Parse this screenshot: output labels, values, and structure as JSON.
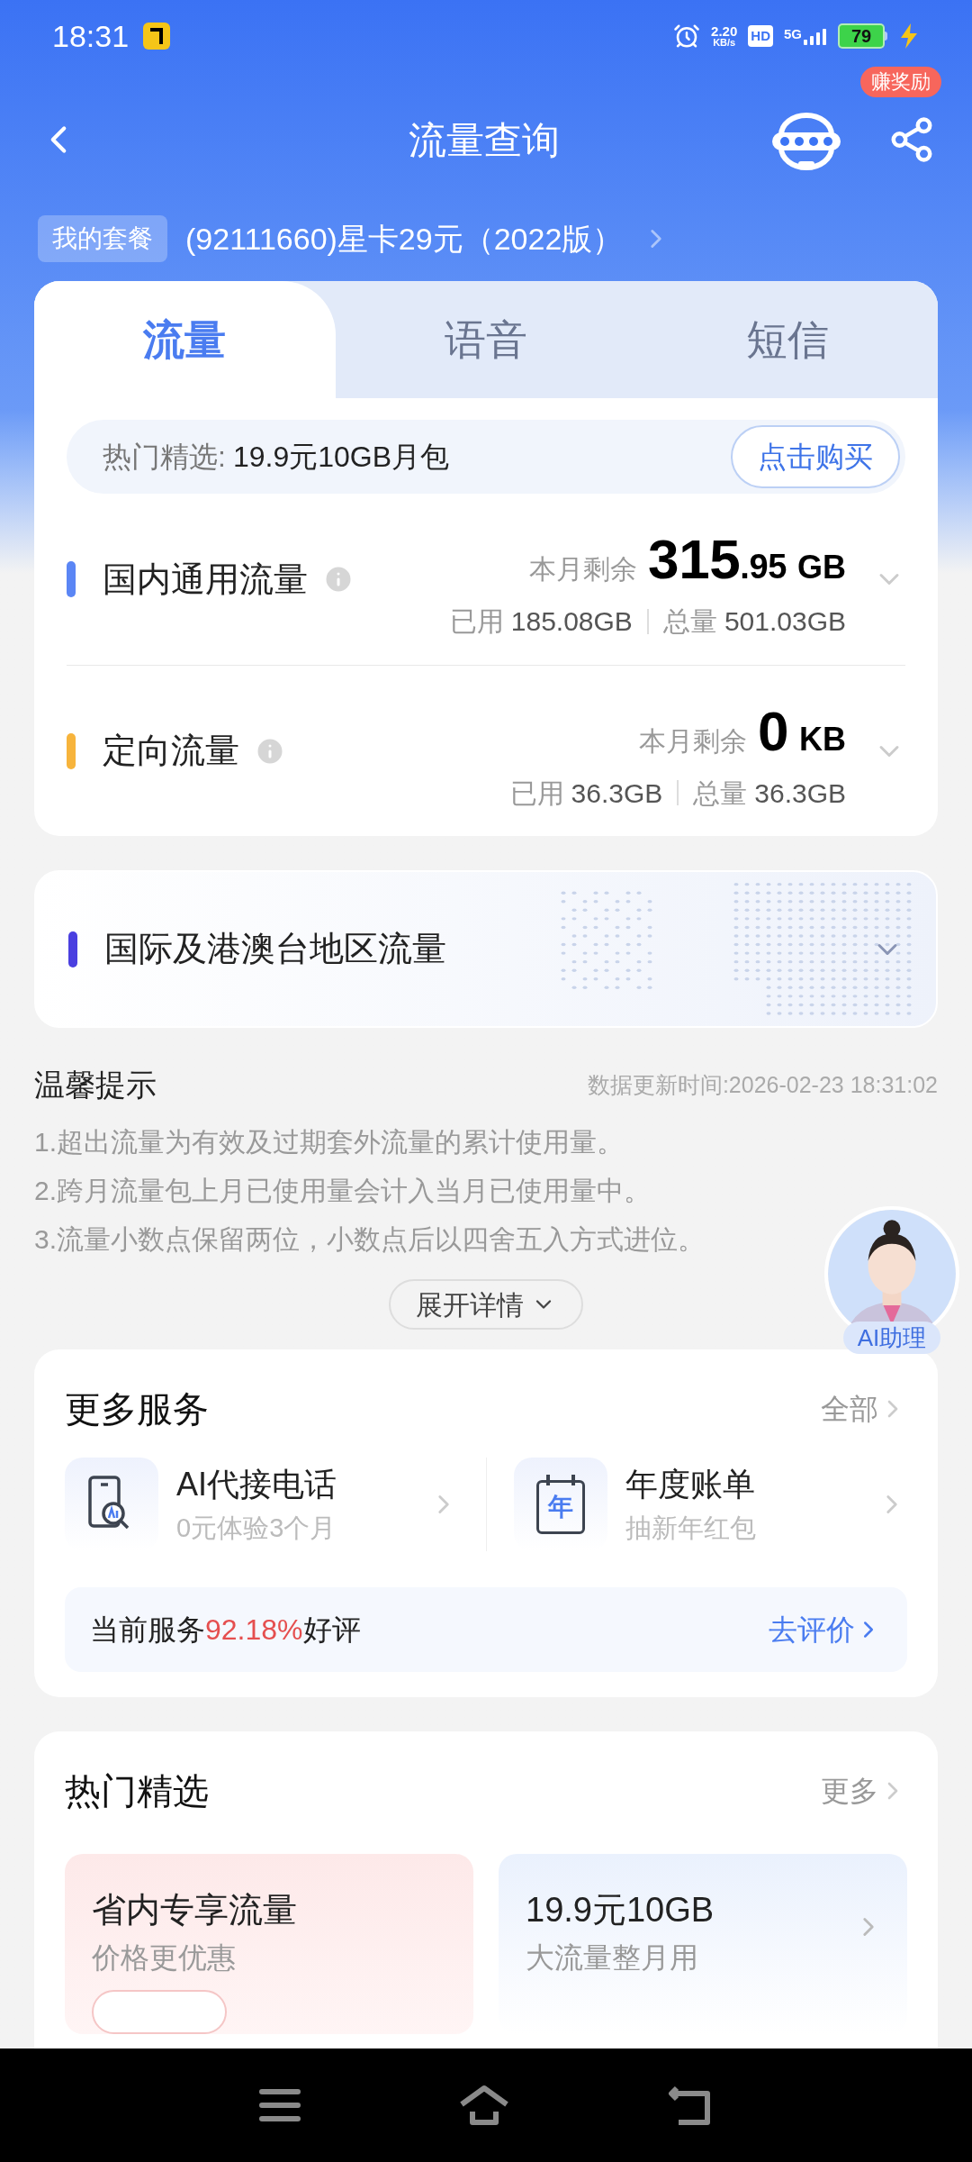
{
  "status_bar": {
    "time": "18:31",
    "speed": "2.20",
    "speed_unit": "KB/s",
    "hd": "HD",
    "network": "5G",
    "battery": "79"
  },
  "header": {
    "title": "流量查询",
    "reward_badge": "赚奖励"
  },
  "plan": {
    "label": "我的套餐",
    "name": "(92111660)星卡29元（2022版）"
  },
  "tabs": [
    {
      "label": "流量",
      "selected": true
    },
    {
      "label": "语音",
      "selected": false
    },
    {
      "label": "短信",
      "selected": false
    }
  ],
  "promo": {
    "label": "热门精选:",
    "offer": "19.9元10GB月包",
    "button": "点击购买"
  },
  "usage": [
    {
      "name": "国内通用流量",
      "color": "#5b86f5",
      "remaining_label": "本月剩余",
      "remaining_main": "315",
      "remaining_fraction": ".95",
      "unit": "GB",
      "used_label": "已用",
      "used": "185.08GB",
      "total_label": "总量",
      "total": "501.03GB"
    },
    {
      "name": "定向流量",
      "color": "#f7b43c",
      "remaining_label": "本月剩余",
      "remaining_main": "0",
      "unit": "KB",
      "used_label": "已用",
      "used": "36.3GB",
      "total_label": "总量",
      "total": "36.3GB"
    }
  ],
  "international": {
    "name": "国际及港澳台地区流量",
    "color": "#4a3fe0"
  },
  "tips": {
    "title": "温馨提示",
    "updated": "数据更新时间:2026-02-23 18:31:02",
    "lines": [
      "1.超出流量为有效及过期套外流量的累计使用量。",
      "2.跨月流量包上月已使用量会计入当月已使用量中。",
      "3.流量小数点保留两位，小数点后以四舍五入方式进位。"
    ],
    "expand": "展开详情"
  },
  "assistant": {
    "label": "AI助理"
  },
  "services": {
    "title": "更多服务",
    "all": "全部",
    "items": [
      {
        "kind": "phone",
        "title": "AI代接电话",
        "subtitle": "0元体验3个月"
      },
      {
        "kind": "calendar",
        "title": "年度账单",
        "subtitle": "抽新年红包",
        "icon_text": "年"
      }
    ],
    "rating_prefix": "当前服务",
    "rating_value": "92.18%",
    "rating_suffix": "好评",
    "rate_link": "去评价"
  },
  "hot": {
    "title": "热门精选",
    "more": "更多",
    "items": [
      {
        "kind": "pink",
        "title": "省内专享流量",
        "subtitle": "价格更优惠"
      },
      {
        "kind": "blue",
        "title": "19.9元10GB",
        "subtitle": "大流量整月用"
      }
    ]
  }
}
